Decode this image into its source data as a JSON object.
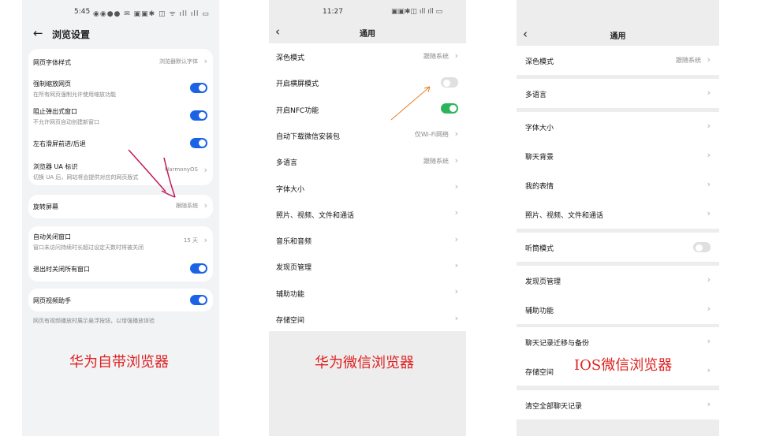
{
  "huawei": {
    "status_time": "5:45",
    "title": "浏览设置",
    "back": "←",
    "groups": [
      [
        {
          "title": "网页字体样式",
          "value": "浏览器默认字体",
          "chev": true
        },
        {
          "title": "强制缩放网页",
          "sub": "在所有网页强制允许使用缩放功能",
          "toggle": "on"
        },
        {
          "title": "阻止弹出式窗口",
          "sub": "不允许网页自动创建新窗口",
          "toggle": "on"
        },
        {
          "title": "左右滑屏前进/后退",
          "toggle": "on"
        },
        {
          "title": "浏览器 UA 标识",
          "sub": "切换 UA 后，网站将会提供对应的网页版式",
          "value": "HarmonyOS",
          "chev": true
        }
      ],
      [
        {
          "title": "旋转屏幕",
          "value": "跟随系统",
          "chev": true
        }
      ],
      [
        {
          "title": "自动关闭窗口",
          "sub": "窗口未访问持续时长超过设定天数时将被关闭",
          "value": "15 天",
          "chev": true
        },
        {
          "title": "退出时关闭所有窗口",
          "toggle": "on"
        }
      ],
      [
        {
          "title": "网页视频助手",
          "toggle": "on"
        }
      ]
    ],
    "footnote": "网页有视频播放时展示悬浮按钮，以增强播放体验",
    "caption": "华为自带浏览器"
  },
  "wechat_huawei": {
    "status_time": "11:27",
    "title": "通用",
    "back": "‹",
    "rows": [
      {
        "title": "深色模式",
        "value": "跟随系统",
        "chev": true
      },
      {
        "title": "开启横屏模式",
        "toggle": "off"
      },
      {
        "title": "开启NFC功能",
        "toggle": "green"
      },
      {
        "title": "自动下载微信安装包",
        "value": "仅Wi-Fi网络",
        "chev": true
      },
      {
        "title": "多语言",
        "value": "跟随系统",
        "chev": true
      },
      {
        "title": "字体大小",
        "chev": true
      },
      {
        "title": "照片、视频、文件和通话",
        "chev": true
      },
      {
        "title": "音乐和音频",
        "chev": true
      },
      {
        "title": "发现页管理",
        "chev": true
      },
      {
        "title": "辅助功能",
        "chev": true
      },
      {
        "title": "存储空间",
        "chev": true
      }
    ],
    "caption": "华为微信浏览器"
  },
  "wechat_ios": {
    "title": "通用",
    "back": "‹",
    "groups": [
      [
        {
          "title": "深色模式",
          "value": "跟随系统",
          "chev": true
        }
      ],
      [
        {
          "title": "多语言",
          "chev": true
        }
      ],
      [
        {
          "title": "字体大小",
          "chev": true
        },
        {
          "title": "聊天背景",
          "chev": true
        },
        {
          "title": "我的表情",
          "chev": true
        },
        {
          "title": "照片、视频、文件和通话",
          "chev": true
        }
      ],
      [
        {
          "title": "听筒模式",
          "toggle": "off"
        }
      ],
      [
        {
          "title": "发现页管理",
          "chev": true
        },
        {
          "title": "辅助功能",
          "chev": true
        }
      ],
      [
        {
          "title": "聊天记录迁移与备份",
          "chev": true
        },
        {
          "title": "存储空间",
          "chev": true
        }
      ],
      [
        {
          "title": "清空全部聊天记录",
          "chev": true
        }
      ]
    ],
    "caption": "IOS微信浏览器"
  },
  "colors": {
    "huawei_toggle": "#1b63e6",
    "wechat_toggle": "#2bb55a",
    "caption": "#e02020"
  }
}
